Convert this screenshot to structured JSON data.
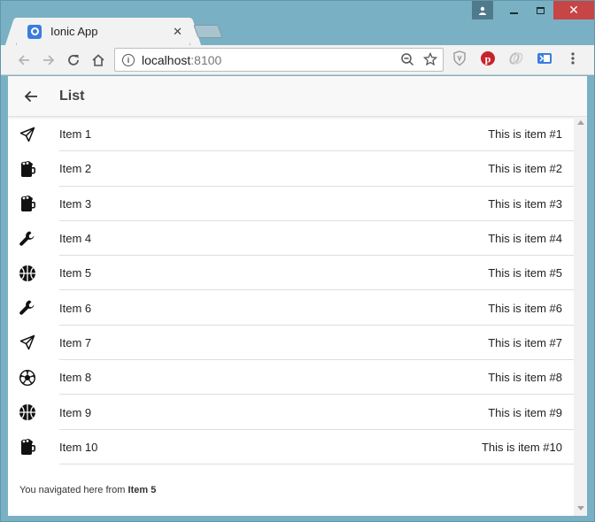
{
  "browser": {
    "tab_title": "Ionic App",
    "url_host": "localhost",
    "url_port": ":8100",
    "accent": "#3a7de0"
  },
  "app": {
    "page_title": "List",
    "footer_prefix": "You navigated here from ",
    "footer_item": "Item 5"
  },
  "items": [
    {
      "label": "Item 1",
      "note": "This is item #1",
      "icon": "paper-plane-icon"
    },
    {
      "label": "Item 2",
      "note": "This is item #2",
      "icon": "beer-icon"
    },
    {
      "label": "Item 3",
      "note": "This is item #3",
      "icon": "beer-icon"
    },
    {
      "label": "Item 4",
      "note": "This is item #4",
      "icon": "wrench-icon"
    },
    {
      "label": "Item 5",
      "note": "This is item #5",
      "icon": "basketball-icon"
    },
    {
      "label": "Item 6",
      "note": "This is item #6",
      "icon": "wrench-icon"
    },
    {
      "label": "Item 7",
      "note": "This is item #7",
      "icon": "paper-plane-icon"
    },
    {
      "label": "Item 8",
      "note": "This is item #8",
      "icon": "football-icon"
    },
    {
      "label": "Item 9",
      "note": "This is item #9",
      "icon": "basketball-icon"
    },
    {
      "label": "Item 10",
      "note": "This is item #10",
      "icon": "beer-icon"
    }
  ]
}
